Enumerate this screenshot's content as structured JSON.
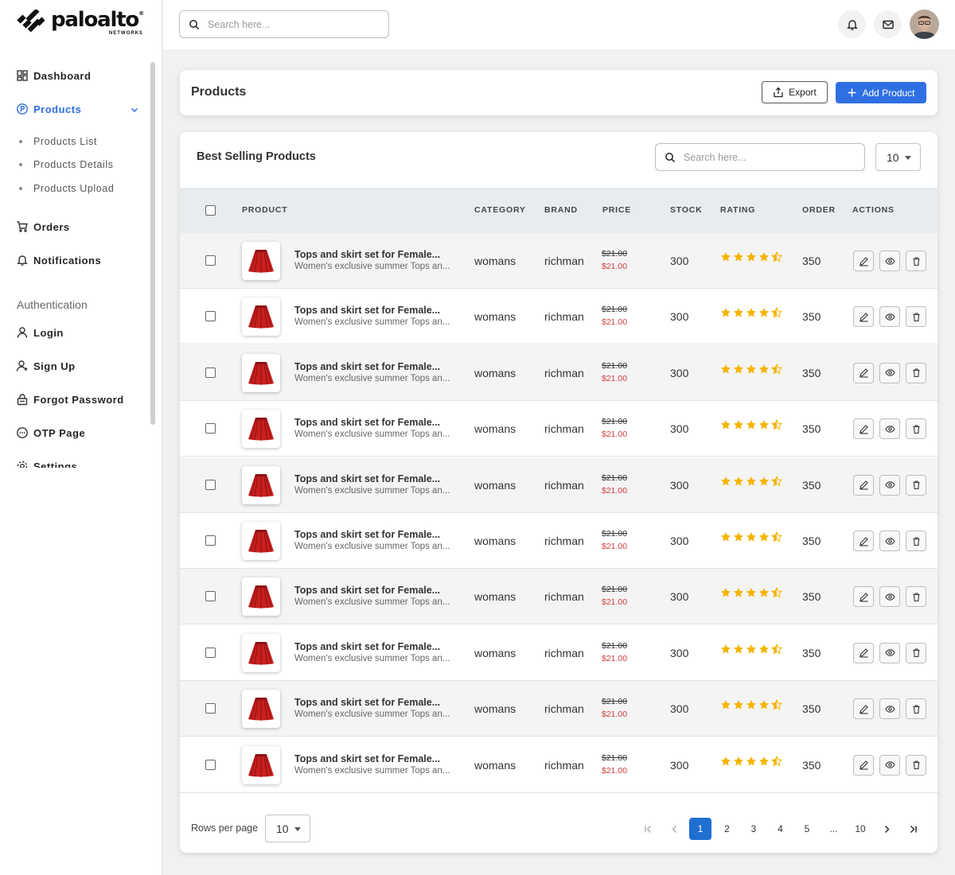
{
  "brand": {
    "name": "paloalto",
    "tagline": "NETWORKS"
  },
  "sidebar": {
    "items": [
      {
        "label": "Dashboard",
        "icon": "dashboard-grid-icon"
      },
      {
        "label": "Products",
        "icon": "products-p-icon",
        "active": true
      }
    ],
    "sub_items": [
      "Products List",
      "Products Details",
      "Products Upload"
    ],
    "items2": [
      {
        "label": "Orders",
        "icon": "cart-icon"
      },
      {
        "label": "Notifications",
        "icon": "bell-icon"
      }
    ],
    "section_title": "Authentication",
    "auth_items": [
      {
        "label": "Login",
        "icon": "user-icon"
      },
      {
        "label": "Sign Up",
        "icon": "user-add-icon"
      },
      {
        "label": "Forgot Password",
        "icon": "lock-icon"
      },
      {
        "label": "OTP Page",
        "icon": "chat-icon"
      },
      {
        "label": "Settings",
        "icon": "gear-icon"
      }
    ]
  },
  "topbar": {
    "search_placeholder": "Search here..."
  },
  "header": {
    "title": "Products",
    "export_label": "Export",
    "add_label": "Add Product"
  },
  "table": {
    "title": "Best Selling Products",
    "search_placeholder": "Search here...",
    "page_size": "10",
    "columns": [
      "PRODUCT",
      "CATEGORY",
      "BRAND",
      "PRICE",
      "STOCK",
      "RATING",
      "ORDER",
      "ACTIONS"
    ],
    "rows": [
      {
        "name": "Tops and skirt set for Female...",
        "desc": "Women's exclusive summer Tops an...",
        "category": "womans",
        "brand": "richman",
        "old_price": "$21.00",
        "price": "$21.00",
        "stock": "300",
        "rating": 4.5,
        "order": "350"
      },
      {
        "name": "Tops and skirt set for Female...",
        "desc": "Women's exclusive summer Tops an...",
        "category": "womans",
        "brand": "richman",
        "old_price": "$21.00",
        "price": "$21.00",
        "stock": "300",
        "rating": 4.5,
        "order": "350"
      },
      {
        "name": "Tops and skirt set for Female...",
        "desc": "Women's exclusive summer Tops an...",
        "category": "womans",
        "brand": "richman",
        "old_price": "$21.00",
        "price": "$21.00",
        "stock": "300",
        "rating": 4.5,
        "order": "350"
      },
      {
        "name": "Tops and skirt set for Female...",
        "desc": "Women's exclusive summer Tops an...",
        "category": "womans",
        "brand": "richman",
        "old_price": "$21.00",
        "price": "$21.00",
        "stock": "300",
        "rating": 4.5,
        "order": "350"
      },
      {
        "name": "Tops and skirt set for Female...",
        "desc": "Women's exclusive summer Tops an...",
        "category": "womans",
        "brand": "richman",
        "old_price": "$21.00",
        "price": "$21.00",
        "stock": "300",
        "rating": 4.5,
        "order": "350"
      },
      {
        "name": "Tops and skirt set for Female...",
        "desc": "Women's exclusive summer Tops an...",
        "category": "womans",
        "brand": "richman",
        "old_price": "$21.00",
        "price": "$21.00",
        "stock": "300",
        "rating": 4.5,
        "order": "350"
      },
      {
        "name": "Tops and skirt set for Female...",
        "desc": "Women's exclusive summer Tops an...",
        "category": "womans",
        "brand": "richman",
        "old_price": "$21.00",
        "price": "$21.00",
        "stock": "300",
        "rating": 4.5,
        "order": "350"
      },
      {
        "name": "Tops and skirt set for Female...",
        "desc": "Women's exclusive summer Tops an...",
        "category": "womans",
        "brand": "richman",
        "old_price": "$21.00",
        "price": "$21.00",
        "stock": "300",
        "rating": 4.5,
        "order": "350"
      },
      {
        "name": "Tops and skirt set for Female...",
        "desc": "Women's exclusive summer Tops an...",
        "category": "womans",
        "brand": "richman",
        "old_price": "$21.00",
        "price": "$21.00",
        "stock": "300",
        "rating": 4.5,
        "order": "350"
      },
      {
        "name": "Tops and skirt set for Female...",
        "desc": "Women's exclusive summer Tops an...",
        "category": "womans",
        "brand": "richman",
        "old_price": "$21.00",
        "price": "$21.00",
        "stock": "300",
        "rating": 4.5,
        "order": "350"
      }
    ]
  },
  "footer": {
    "rows_per_page_label": "Rows per page",
    "rows_per_page": "10",
    "pages": [
      "1",
      "2",
      "3",
      "4",
      "5",
      "...",
      "10"
    ],
    "current_page": "1"
  },
  "colors": {
    "accent": "#2f6fe4",
    "page_active": "#1f6fd1",
    "star": "#f5b400",
    "sale_price": "#d23a3a"
  }
}
